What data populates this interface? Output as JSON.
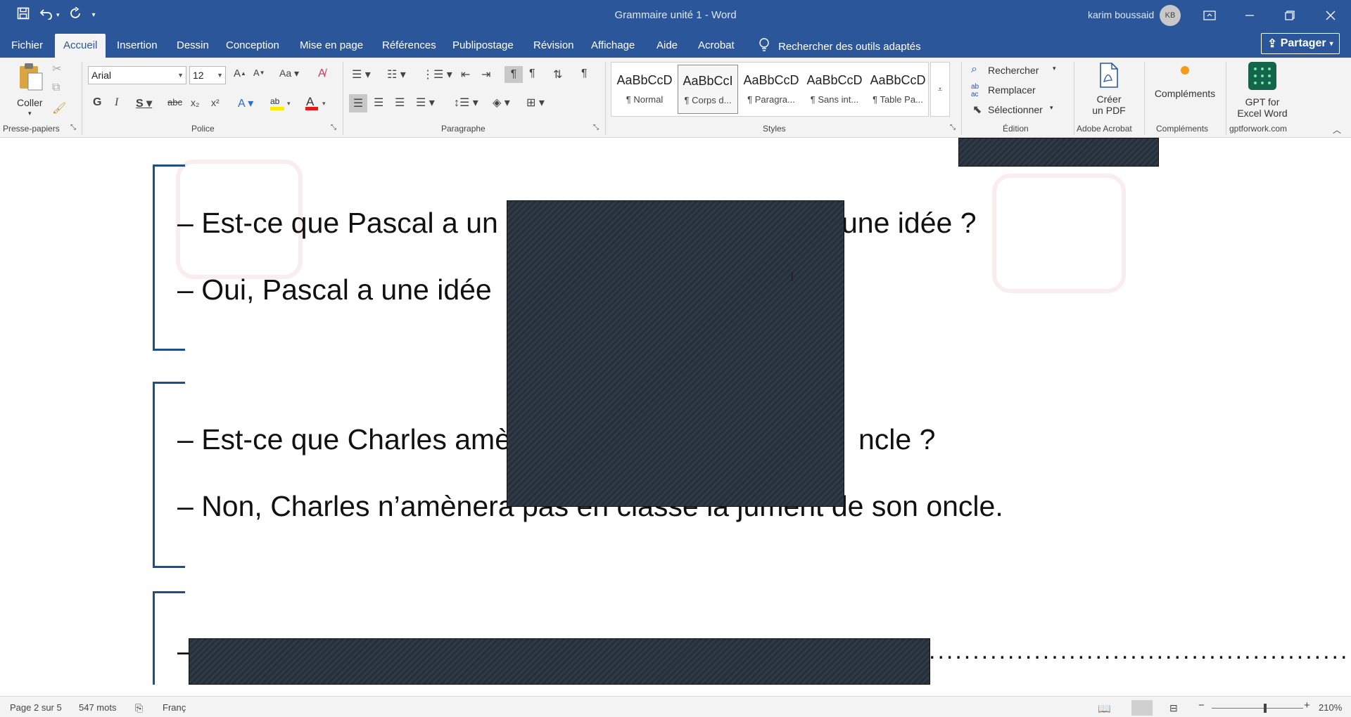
{
  "titlebar": {
    "title": "Grammaire unité 1  -  Word",
    "user": "karim boussaid",
    "initials": "KB"
  },
  "tabs": [
    "Fichier",
    "Accueil",
    "Insertion",
    "Dessin",
    "Conception",
    "Mise en page",
    "Références",
    "Publipostage",
    "Révision",
    "Affichage",
    "Aide",
    "Acrobat"
  ],
  "tell_me": "Rechercher des outils adaptés",
  "share": "Partager",
  "ribbon": {
    "clipboard": {
      "paste": "Coller",
      "label": "Presse-papiers"
    },
    "font": {
      "name": "Arial",
      "size": "12",
      "label": "Police"
    },
    "paragraph": {
      "label": "Paragraphe"
    },
    "styles": {
      "label": "Styles",
      "items": [
        {
          "sample": "AaBbCcD",
          "name": "¶ Normal"
        },
        {
          "sample": "AaBbCcI",
          "name": "¶ Corps d..."
        },
        {
          "sample": "AaBbCcD",
          "name": "¶ Paragra..."
        },
        {
          "sample": "AaBbCcD",
          "name": "¶ Sans int..."
        },
        {
          "sample": "AaBbCcD",
          "name": "¶ Table Pa..."
        }
      ]
    },
    "editing": {
      "find": "Rechercher",
      "replace": "Remplacer",
      "select": "Sélectionner",
      "label": "Édition"
    },
    "acrobat": {
      "create": "Créer",
      "create2": "un PDF",
      "label": "Adobe Acrobat"
    },
    "addins": {
      "button": "Compléments",
      "label": "Compléments"
    },
    "gpt": {
      "line1": "GPT for",
      "line2": "Excel Word",
      "label": "gptforwork.com"
    }
  },
  "document": {
    "line1": "– Est-ce que Pascal a un",
    "line1_end": "une idée ?",
    "line2": "– Oui, Pascal a une  idée",
    "line3": "– Est-ce que Charles amè",
    "line3_end": "ncle ?",
    "line4": "– Non, Charles n’amènera pas en classe la jument de son  oncle.",
    "line5_prefix": "–",
    "dotted_leader": "....................................................."
  },
  "status": {
    "page": "Page 2 sur 5",
    "words": "547 mots",
    "language": "Franç",
    "zoom": "210%"
  }
}
